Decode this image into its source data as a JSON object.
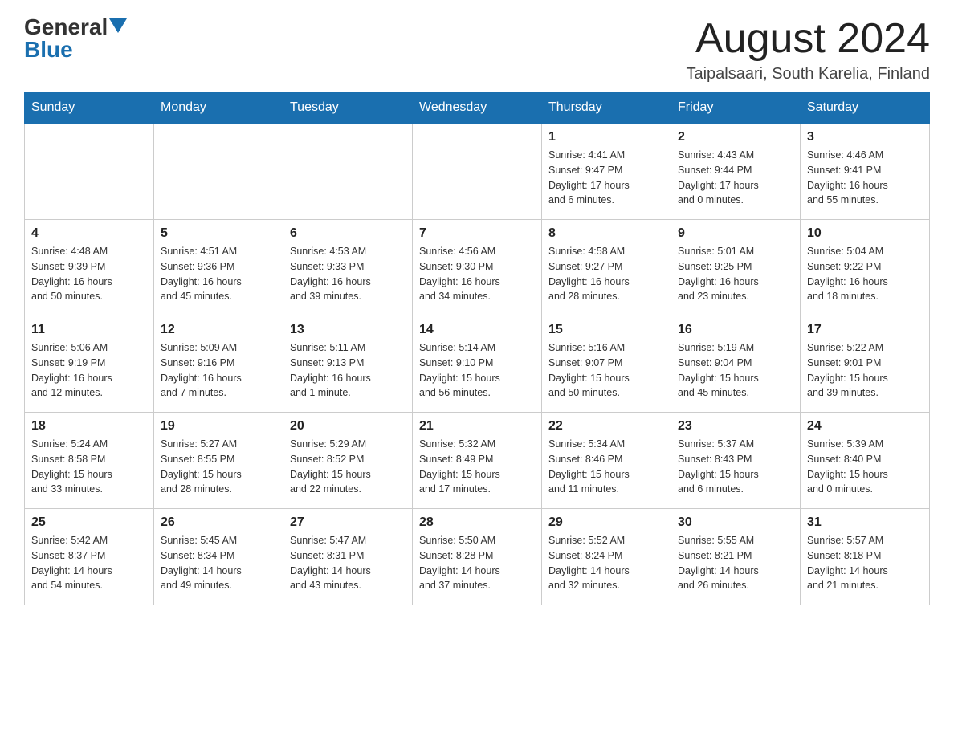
{
  "header": {
    "logo_general": "General",
    "logo_blue": "Blue",
    "month_year": "August 2024",
    "location": "Taipalsaari, South Karelia, Finland"
  },
  "weekdays": [
    "Sunday",
    "Monday",
    "Tuesday",
    "Wednesday",
    "Thursday",
    "Friday",
    "Saturday"
  ],
  "weeks": [
    [
      {
        "day": "",
        "info": ""
      },
      {
        "day": "",
        "info": ""
      },
      {
        "day": "",
        "info": ""
      },
      {
        "day": "",
        "info": ""
      },
      {
        "day": "1",
        "info": "Sunrise: 4:41 AM\nSunset: 9:47 PM\nDaylight: 17 hours\nand 6 minutes."
      },
      {
        "day": "2",
        "info": "Sunrise: 4:43 AM\nSunset: 9:44 PM\nDaylight: 17 hours\nand 0 minutes."
      },
      {
        "day": "3",
        "info": "Sunrise: 4:46 AM\nSunset: 9:41 PM\nDaylight: 16 hours\nand 55 minutes."
      }
    ],
    [
      {
        "day": "4",
        "info": "Sunrise: 4:48 AM\nSunset: 9:39 PM\nDaylight: 16 hours\nand 50 minutes."
      },
      {
        "day": "5",
        "info": "Sunrise: 4:51 AM\nSunset: 9:36 PM\nDaylight: 16 hours\nand 45 minutes."
      },
      {
        "day": "6",
        "info": "Sunrise: 4:53 AM\nSunset: 9:33 PM\nDaylight: 16 hours\nand 39 minutes."
      },
      {
        "day": "7",
        "info": "Sunrise: 4:56 AM\nSunset: 9:30 PM\nDaylight: 16 hours\nand 34 minutes."
      },
      {
        "day": "8",
        "info": "Sunrise: 4:58 AM\nSunset: 9:27 PM\nDaylight: 16 hours\nand 28 minutes."
      },
      {
        "day": "9",
        "info": "Sunrise: 5:01 AM\nSunset: 9:25 PM\nDaylight: 16 hours\nand 23 minutes."
      },
      {
        "day": "10",
        "info": "Sunrise: 5:04 AM\nSunset: 9:22 PM\nDaylight: 16 hours\nand 18 minutes."
      }
    ],
    [
      {
        "day": "11",
        "info": "Sunrise: 5:06 AM\nSunset: 9:19 PM\nDaylight: 16 hours\nand 12 minutes."
      },
      {
        "day": "12",
        "info": "Sunrise: 5:09 AM\nSunset: 9:16 PM\nDaylight: 16 hours\nand 7 minutes."
      },
      {
        "day": "13",
        "info": "Sunrise: 5:11 AM\nSunset: 9:13 PM\nDaylight: 16 hours\nand 1 minute."
      },
      {
        "day": "14",
        "info": "Sunrise: 5:14 AM\nSunset: 9:10 PM\nDaylight: 15 hours\nand 56 minutes."
      },
      {
        "day": "15",
        "info": "Sunrise: 5:16 AM\nSunset: 9:07 PM\nDaylight: 15 hours\nand 50 minutes."
      },
      {
        "day": "16",
        "info": "Sunrise: 5:19 AM\nSunset: 9:04 PM\nDaylight: 15 hours\nand 45 minutes."
      },
      {
        "day": "17",
        "info": "Sunrise: 5:22 AM\nSunset: 9:01 PM\nDaylight: 15 hours\nand 39 minutes."
      }
    ],
    [
      {
        "day": "18",
        "info": "Sunrise: 5:24 AM\nSunset: 8:58 PM\nDaylight: 15 hours\nand 33 minutes."
      },
      {
        "day": "19",
        "info": "Sunrise: 5:27 AM\nSunset: 8:55 PM\nDaylight: 15 hours\nand 28 minutes."
      },
      {
        "day": "20",
        "info": "Sunrise: 5:29 AM\nSunset: 8:52 PM\nDaylight: 15 hours\nand 22 minutes."
      },
      {
        "day": "21",
        "info": "Sunrise: 5:32 AM\nSunset: 8:49 PM\nDaylight: 15 hours\nand 17 minutes."
      },
      {
        "day": "22",
        "info": "Sunrise: 5:34 AM\nSunset: 8:46 PM\nDaylight: 15 hours\nand 11 minutes."
      },
      {
        "day": "23",
        "info": "Sunrise: 5:37 AM\nSunset: 8:43 PM\nDaylight: 15 hours\nand 6 minutes."
      },
      {
        "day": "24",
        "info": "Sunrise: 5:39 AM\nSunset: 8:40 PM\nDaylight: 15 hours\nand 0 minutes."
      }
    ],
    [
      {
        "day": "25",
        "info": "Sunrise: 5:42 AM\nSunset: 8:37 PM\nDaylight: 14 hours\nand 54 minutes."
      },
      {
        "day": "26",
        "info": "Sunrise: 5:45 AM\nSunset: 8:34 PM\nDaylight: 14 hours\nand 49 minutes."
      },
      {
        "day": "27",
        "info": "Sunrise: 5:47 AM\nSunset: 8:31 PM\nDaylight: 14 hours\nand 43 minutes."
      },
      {
        "day": "28",
        "info": "Sunrise: 5:50 AM\nSunset: 8:28 PM\nDaylight: 14 hours\nand 37 minutes."
      },
      {
        "day": "29",
        "info": "Sunrise: 5:52 AM\nSunset: 8:24 PM\nDaylight: 14 hours\nand 32 minutes."
      },
      {
        "day": "30",
        "info": "Sunrise: 5:55 AM\nSunset: 8:21 PM\nDaylight: 14 hours\nand 26 minutes."
      },
      {
        "day": "31",
        "info": "Sunrise: 5:57 AM\nSunset: 8:18 PM\nDaylight: 14 hours\nand 21 minutes."
      }
    ]
  ]
}
